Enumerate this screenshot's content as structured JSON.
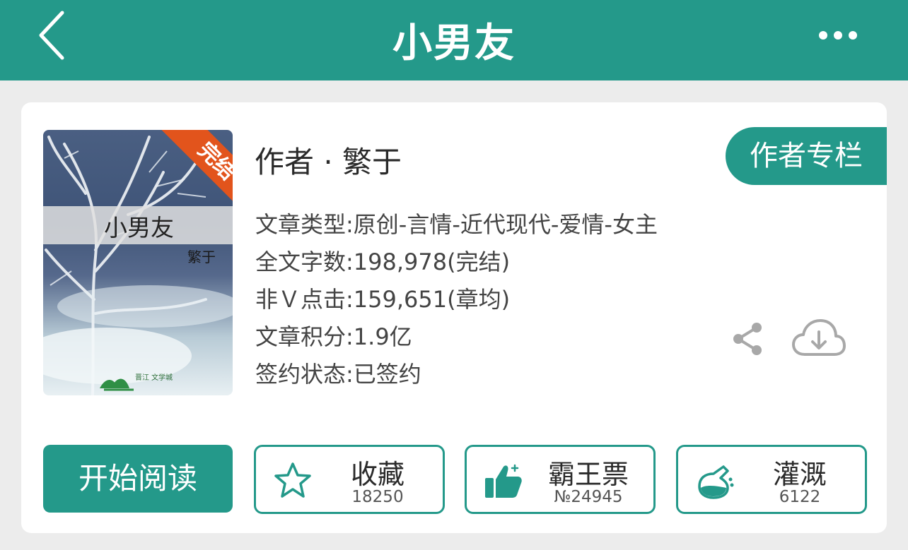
{
  "header": {
    "title": "小男友"
  },
  "cover": {
    "title": "小男友",
    "author": "繁于",
    "ribbon": "完结",
    "logo_text": "晋江 文学城"
  },
  "author_line": "作者 · 繁于",
  "author_column_button": "作者专栏",
  "info": [
    "文章类型:原创-言情-近代现代-爱情-女主",
    "全文字数:198,978(完结)",
    "非Ｖ点击:159,651(章均)",
    "文章积分:1.9亿",
    "签约状态:已签约"
  ],
  "read_button": "开始阅读",
  "actions": [
    {
      "label": "收藏",
      "count": "18250",
      "icon": "star-icon"
    },
    {
      "label": "霸王票",
      "count": "№24945",
      "icon": "thumbs-up-icon"
    },
    {
      "label": "灌溉",
      "count": "6122",
      "icon": "watering-flask-icon"
    }
  ],
  "colors": {
    "accent": "#24998a",
    "ribbon": "#e2541c",
    "icon_gray": "#a8a8a8"
  }
}
